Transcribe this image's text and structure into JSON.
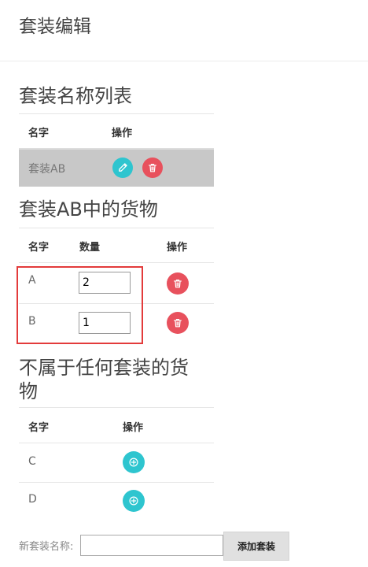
{
  "page": {
    "title": "套装编辑"
  },
  "suite_list": {
    "title": "套装名称列表",
    "headers": {
      "name": "名字",
      "action": "操作"
    },
    "rows": [
      {
        "name": "套装AB"
      }
    ]
  },
  "suite_goods": {
    "title": "套装AB中的货物",
    "headers": {
      "name": "名字",
      "quantity": "数量",
      "action": "操作"
    },
    "rows": [
      {
        "name": "A",
        "quantity": "2"
      },
      {
        "name": "B",
        "quantity": "1"
      }
    ]
  },
  "unassigned_goods": {
    "title_line1": "不属于任何套装的货",
    "title_line2": "物",
    "headers": {
      "name": "名字",
      "action": "操作"
    },
    "rows": [
      {
        "name": "C"
      },
      {
        "name": "D"
      }
    ]
  },
  "new_suite": {
    "label": "新套装名称:",
    "value": "",
    "button_label": "添加套装"
  },
  "colors": {
    "accent_teal": "#2ec5cf",
    "danger_red": "#e8515d",
    "selected_row": "#c8c8c8",
    "highlight_border": "#e33b3b"
  },
  "icons": {
    "edit": "pencil-icon",
    "delete": "trash-icon",
    "add": "plus-circle-icon"
  }
}
